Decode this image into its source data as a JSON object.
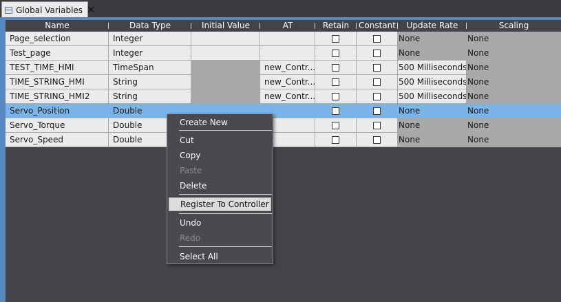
{
  "tab": {
    "label": "Global Variables",
    "close": "✕",
    "icon_text": "html"
  },
  "columns": [
    "Name",
    "Data Type",
    "Initial Value",
    "AT",
    "Retain",
    "Constant",
    "Update Rate",
    "Scaling"
  ],
  "rows": [
    {
      "name": "Page_selection",
      "type": "Integer",
      "initial": "",
      "at": "",
      "rate": "None",
      "scaling": "None"
    },
    {
      "name": "Test_page",
      "type": "Integer",
      "initial": "",
      "at": "",
      "rate": "None",
      "scaling": "None"
    },
    {
      "name": "TEST_TIME_HMI",
      "type": "TimeSpan",
      "initial": "",
      "at": "new_Contr...",
      "rate": "500 Milliseconds",
      "scaling": "None"
    },
    {
      "name": "TIME_STRING_HMI",
      "type": "String",
      "initial": "",
      "at": "new_Contr...",
      "rate": "500 Milliseconds",
      "scaling": "None"
    },
    {
      "name": "TIME_STRING_HMI2",
      "type": "String",
      "initial": "",
      "at": "new_Contr...",
      "rate": "500 Milliseconds",
      "scaling": "None"
    },
    {
      "name": "Servo_Position",
      "type": "Double",
      "initial": "",
      "at": "",
      "rate": "None",
      "scaling": "None"
    },
    {
      "name": "Servo_Torque",
      "type": "Double",
      "initial": "",
      "at": "",
      "rate": "None",
      "scaling": "None"
    },
    {
      "name": "Servo_Speed",
      "type": "Double",
      "initial": "",
      "at": "",
      "rate": "None",
      "scaling": "None"
    }
  ],
  "context_menu": {
    "create_new": "Create New",
    "cut": "Cut",
    "copy": "Copy",
    "paste": "Paste",
    "delete": "Delete",
    "register": "Register To Controller",
    "undo": "Undo",
    "redo": "Redo",
    "select_all": "Select All"
  },
  "colors": {
    "selected_row": "#7ab4e8",
    "accent_frame": "#5a88c3",
    "background": "#434348"
  }
}
